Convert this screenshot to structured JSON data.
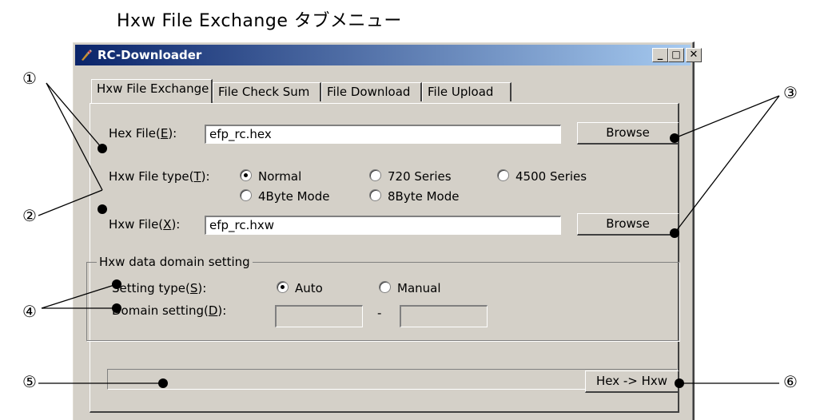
{
  "caption": "Hxw File Exchange タブメニュー",
  "window": {
    "title": "RC-Downloader",
    "controls": {
      "minimize": "_",
      "maximize": "□",
      "close": "✕"
    }
  },
  "tabs": [
    {
      "label": "Hxw File Exchange",
      "active": true
    },
    {
      "label": "File Check Sum",
      "active": false
    },
    {
      "label": "File Download",
      "active": false
    },
    {
      "label": "File Upload",
      "active": false
    }
  ],
  "hex_file": {
    "label_pre": "Hex File(",
    "mnemonic": "E",
    "label_post": "):",
    "value": "efp_rc.hex",
    "browse_label": "Browse"
  },
  "hxw_file_type": {
    "label_pre": "Hxw File type(",
    "mnemonic": "T",
    "label_post": "):",
    "options": [
      {
        "label": "Normal",
        "selected": true
      },
      {
        "label": "720 Series",
        "selected": false
      },
      {
        "label": "4500 Series",
        "selected": false
      },
      {
        "label": "4Byte Mode",
        "selected": false
      },
      {
        "label": "8Byte Mode",
        "selected": false
      }
    ]
  },
  "hxw_file": {
    "label_pre": "Hxw File(",
    "mnemonic": "X",
    "label_post": "):",
    "value": "efp_rc.hxw",
    "browse_label": "Browse"
  },
  "domain_group": {
    "title": "Hxw data domain setting",
    "setting_type": {
      "label_pre": "Setting type(",
      "mnemonic": "S",
      "label_post": "):",
      "options": [
        {
          "label": "Auto",
          "selected": true
        },
        {
          "label": "Manual",
          "selected": false
        }
      ]
    },
    "domain_setting": {
      "label_pre": "Domain setting(",
      "mnemonic": "D",
      "label_post": "):",
      "from": "",
      "separator": "-",
      "to": ""
    }
  },
  "progress": {
    "value": 0
  },
  "convert_button": "Hex -> Hxw",
  "callouts": [
    "①",
    "②",
    "③",
    "④",
    "⑤",
    "⑥"
  ]
}
